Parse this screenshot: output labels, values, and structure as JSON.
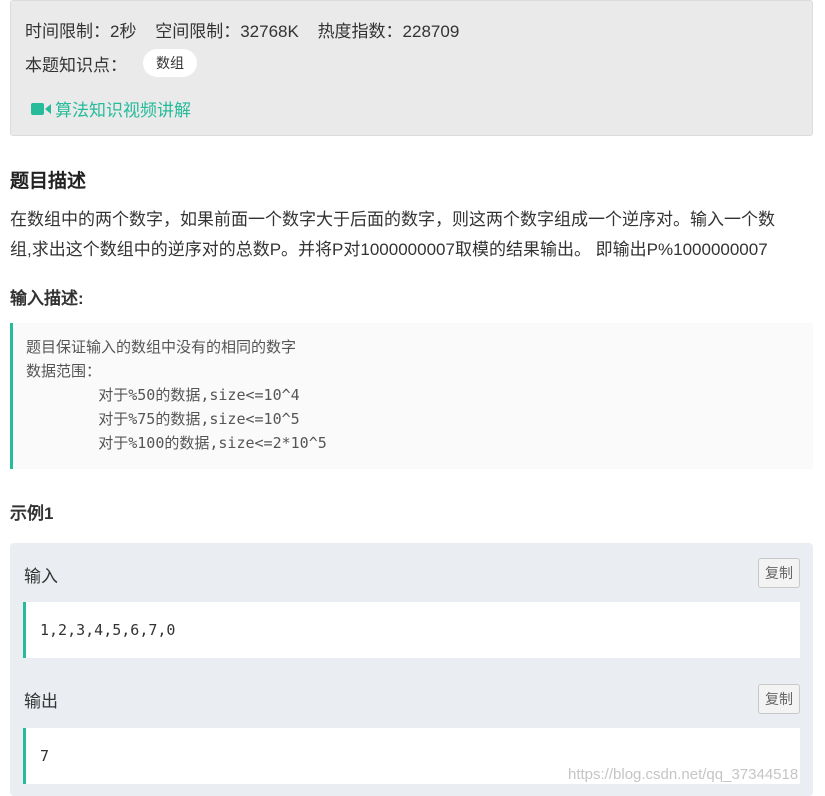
{
  "info": {
    "time_limit": "时间限制：2秒",
    "space_limit": "空间限制：32768K",
    "heat_index": "热度指数：228709",
    "knowledge_label": "本题知识点：",
    "knowledge_tag": "数组",
    "video_link": "算法知识视频讲解",
    "video_icon": "video-camera-icon",
    "accent_color": "#25bb9b"
  },
  "problem": {
    "title": "题目描述",
    "description_lines": [
      "在数组中的两个数字，如果前面一个数字大于后面的数字，则这两个数字组成一个逆序对。输入一个数",
      "组,求出这个数组中的逆序对的总数P。并将P对1000000007取模的结果输出。 即输出P%1000000007"
    ],
    "input_title": "输入描述:",
    "input_desc": "题目保证输入的数组中没有的相同的数字\n数据范围：\n\t对于%50的数据,size<=10^4\n\t对于%75的数据,size<=10^5\n\t对于%100的数据,size<=2*10^5"
  },
  "example": {
    "title": "示例1",
    "input_label": "输入",
    "input_value": "1,2,3,4,5,6,7,0",
    "output_label": "输出",
    "output_value": "7",
    "copy_label": "复制"
  },
  "watermark": "https://blog.csdn.net/qq_37344518"
}
